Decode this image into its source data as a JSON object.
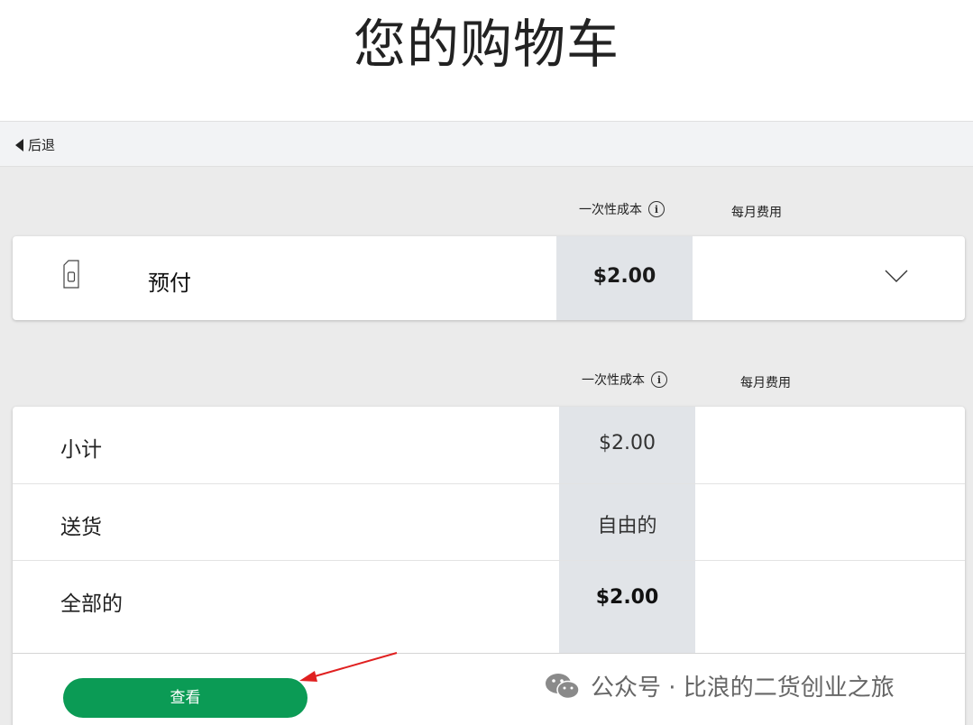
{
  "page": {
    "title": "您的购物车"
  },
  "nav": {
    "back_label": "后退"
  },
  "columns_top": {
    "one_time": "一次性成本",
    "monthly": "每月费用"
  },
  "cart_item": {
    "name": "预付",
    "one_time_price": "$2.00",
    "icon": "sim-card-icon"
  },
  "columns_bottom": {
    "one_time": "一次性成本",
    "monthly": "每月费用"
  },
  "summary": {
    "rows": [
      {
        "label": "小计",
        "value": "$2.00"
      },
      {
        "label": "送货",
        "value": "自由的"
      },
      {
        "label": "全部的",
        "value": "$2.00"
      }
    ]
  },
  "actions": {
    "view_label": "查看"
  },
  "watermark": {
    "text": "公众号 · 比浪的二货创业之旅"
  },
  "colors": {
    "accent_green": "#0b9b55",
    "price_column": "#e1e4e8",
    "annotation_arrow": "#e02020"
  }
}
